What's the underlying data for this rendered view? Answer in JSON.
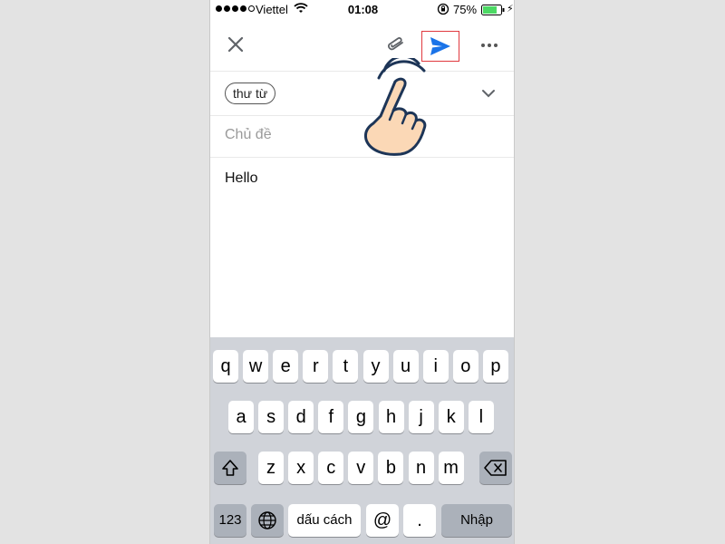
{
  "status_bar": {
    "carrier": "Viettel",
    "time": "01:08",
    "battery_pct": "75%",
    "signal_bars_filled": 4,
    "signal_bars_total": 5
  },
  "toolbar": {
    "close_icon": "close-icon",
    "attach_icon": "paperclip-icon",
    "send_icon": "send-icon",
    "more_icon": "more-horizontal-icon",
    "send_highlight_color": "#e0383e",
    "send_color": "#1a73e8"
  },
  "compose": {
    "recipient_chip": "thư từ",
    "subject_placeholder": "Chủ đề",
    "body": "Hello"
  },
  "keyboard": {
    "row1": [
      "q",
      "w",
      "e",
      "r",
      "t",
      "y",
      "u",
      "i",
      "o",
      "p"
    ],
    "row2": [
      "a",
      "s",
      "d",
      "f",
      "g",
      "h",
      "j",
      "k",
      "l"
    ],
    "row3": [
      "z",
      "x",
      "c",
      "v",
      "b",
      "n",
      "m"
    ],
    "numbers_key": "123",
    "globe_icon": "globe-icon",
    "space_key": "dấu cách",
    "at_key": "@",
    "dot_key": ".",
    "return_key": "Nhập",
    "shift_icon": "shift-icon",
    "backspace_icon": "backspace-icon"
  }
}
